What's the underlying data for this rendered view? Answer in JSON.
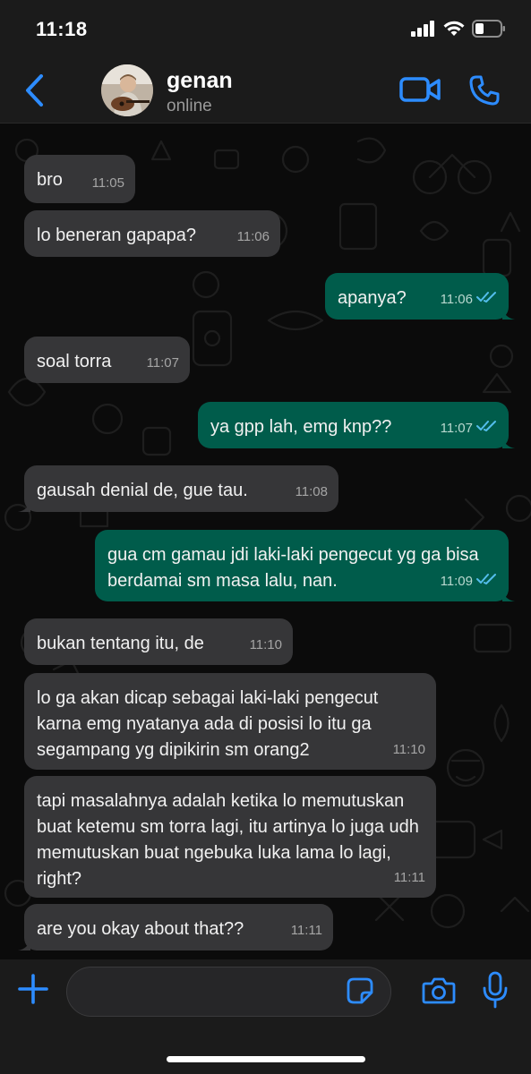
{
  "status_bar": {
    "time": "11:18"
  },
  "header": {
    "contact_name": "genan",
    "contact_status": "online"
  },
  "colors": {
    "accent": "#2d8cff",
    "incoming_bubble": "#363638",
    "outgoing_bubble": "#005c4b",
    "read_ticks": "#53bdeb"
  },
  "messages": [
    {
      "direction": "in",
      "text": "bro",
      "time": "11:05"
    },
    {
      "direction": "in",
      "text": "lo beneran gapapa?",
      "time": "11:06"
    },
    {
      "direction": "out",
      "text": "apanya?",
      "time": "11:06",
      "status": "read"
    },
    {
      "direction": "in",
      "text": "soal torra",
      "time": "11:07"
    },
    {
      "direction": "out",
      "text": "ya gpp lah, emg knp??",
      "time": "11:07",
      "status": "read"
    },
    {
      "direction": "in",
      "text": "gausah denial de, gue tau.",
      "time": "11:08"
    },
    {
      "direction": "out",
      "text": "gua cm gamau jdi laki-laki pengecut yg ga bisa berdamai sm masa lalu, nan.",
      "time": "11:09",
      "status": "read"
    },
    {
      "direction": "in",
      "text": "bukan tentang itu, de",
      "time": "11:10"
    },
    {
      "direction": "in",
      "text": "lo ga akan dicap sebagai laki-laki pengecut karna emg nyatanya ada di posisi lo itu ga segampang yg dipikirin sm orang2",
      "time": "11:10"
    },
    {
      "direction": "in",
      "text": "tapi masalahnya adalah ketika lo memutuskan buat ketemu sm torra lagi, itu artinya lo juga udh memutuskan buat ngebuka luka lama lo lagi, right?",
      "time": "11:11"
    },
    {
      "direction": "in",
      "text": "are you okay about that??",
      "time": "11:11"
    }
  ],
  "input": {
    "value": "",
    "placeholder": ""
  },
  "icons": {
    "back": "chevron-left-icon",
    "video": "video-camera-icon",
    "call": "phone-icon",
    "add": "plus-icon",
    "sticker": "sticker-icon",
    "camera": "camera-icon",
    "mic": "microphone-icon"
  }
}
